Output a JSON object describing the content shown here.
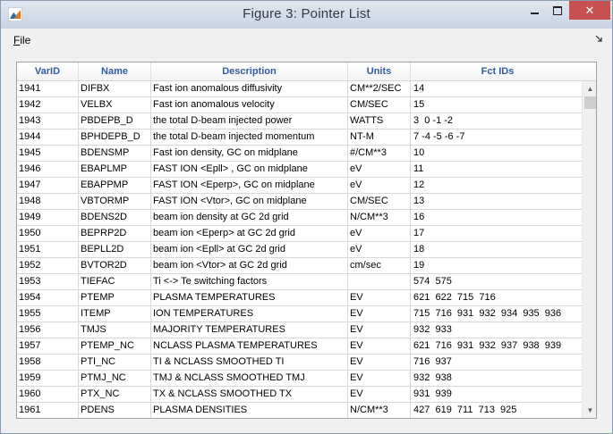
{
  "window": {
    "title": "Figure 3: Pointer List",
    "app_icon": "matlab-icon",
    "close_label": "✕"
  },
  "menubar": {
    "file_label_underlined": "F",
    "file_label_rest": "ile",
    "dock_icon": "dock-arrow-icon"
  },
  "table": {
    "headers": [
      "VarID",
      "Name",
      "Description",
      "Units",
      "Fct IDs"
    ],
    "rows": [
      [
        "1941",
        "DIFBX",
        "Fast ion anomalous diffusivity",
        "CM**2/SEC",
        "14"
      ],
      [
        "1942",
        "VELBX",
        "Fast ion anomalous velocity",
        "CM/SEC",
        "15"
      ],
      [
        "1943",
        "PBDEPB_D",
        "the total D-beam injected power",
        "WATTS",
        "3  0 -1 -2"
      ],
      [
        "1944",
        "BPHDEPB_D",
        "the total D-beam injected momentum",
        "NT-M",
        "7 -4 -5 -6 -7"
      ],
      [
        "1945",
        "BDENSMP",
        "Fast ion density, GC on midplane",
        "#/CM**3",
        "10"
      ],
      [
        "1946",
        "EBAPLMP",
        "FAST ION <Epll> , GC on midplane",
        "eV",
        "11"
      ],
      [
        "1947",
        "EBAPPMP",
        "FAST ION <Eperp>, GC on midplane",
        "eV",
        "12"
      ],
      [
        "1948",
        "VBTORMP",
        "FAST ION <Vtor>, GC on midplane",
        "CM/SEC",
        "13"
      ],
      [
        "1949",
        "BDENS2D",
        "beam ion density at GC 2d grid",
        "N/CM**3",
        "16"
      ],
      [
        "1950",
        "BEPRP2D",
        "beam ion <Eperp> at GC 2d grid",
        "eV",
        "17"
      ],
      [
        "1951",
        "BEPLL2D",
        "beam ion <Epll> at GC 2d grid",
        "eV",
        "18"
      ],
      [
        "1952",
        "BVTOR2D",
        "beam ion <Vtor> at GC 2d grid",
        "cm/sec",
        "19"
      ],
      [
        "1953",
        "TIEFAC",
        "Ti <-> Te switching factors",
        "",
        "574  575"
      ],
      [
        "1954",
        "PTEMP",
        "PLASMA TEMPERATURES",
        "EV",
        "621  622  715  716"
      ],
      [
        "1955",
        "ITEMP",
        "ION TEMPERATURES",
        "EV",
        "715  716  931  932  934  935  936"
      ],
      [
        "1956",
        "TMJS",
        "MAJORITY TEMPERATURES",
        "EV",
        "932  933"
      ],
      [
        "1957",
        "PTEMP_NC",
        "NCLASS PLASMA TEMPERATURES",
        "EV",
        "621  716  931  932  937  938  939"
      ],
      [
        "1958",
        "PTI_NC",
        "TI & NCLASS SMOOTHED TI",
        "EV",
        "716  937"
      ],
      [
        "1959",
        "PTMJ_NC",
        "TMJ & NCLASS SMOOTHED TMJ",
        "EV",
        "932  938"
      ],
      [
        "1960",
        "PTX_NC",
        "TX & NCLASS SMOOTHED TX",
        "EV",
        "931  939"
      ],
      [
        "1961",
        "PDENS",
        "PLASMA DENSITIES",
        "N/CM**3",
        "427  619  711  713  925"
      ]
    ]
  },
  "scrollbar": {
    "up_arrow": "▲",
    "down_arrow": "▼",
    "position_fraction": 0.0
  }
}
